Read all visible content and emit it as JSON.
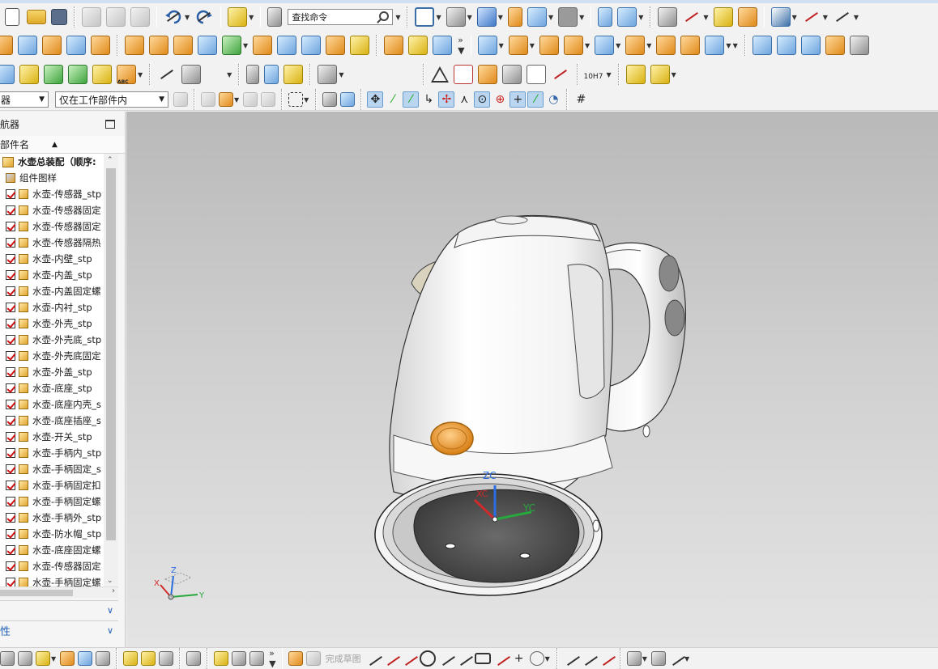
{
  "toolbar_top": {
    "search_placeholder": "查找命令"
  },
  "filter_bar": {
    "type_filter_value": "器",
    "scope_filter_value": "仅在工作部件内"
  },
  "navigator": {
    "title": "导航器",
    "column_header": "性部件名",
    "root": "水壶总装配（顺序:",
    "pattern": "组件图样",
    "items": [
      "水壶-传感器_stp",
      "水壶-传感器固定",
      "水壶-传感器固定",
      "水壶-传感器隔热",
      "水壶-内壁_stp",
      "水壶-内盖_stp",
      "水壶-内盖固定螺",
      "水壶-内衬_stp",
      "水壶-外壳_stp",
      "水壶-外壳底_stp",
      "水壶-外壳底固定",
      "水壶-外盖_stp",
      "水壶-底座_stp",
      "水壶-底座内壳_s",
      "水壶-底座插座_s",
      "水壶-开关_stp",
      "水壶-手柄内_stp",
      "水壶-手柄固定_s",
      "水壶-手柄固定扣",
      "水壶-手柄固定螺",
      "水壶-手柄外_stp",
      "水壶-防水帽_stp",
      "水壶-底座固定螺",
      "水壶-传感器固定",
      "水壶-手柄固定螺"
    ],
    "section_dependencies": "",
    "section_properties": "性"
  },
  "viewport": {
    "wcs_labels": {
      "zc": "ZC",
      "xc": "XC",
      "yc": "YC"
    },
    "triad_labels": {
      "x": "X",
      "y": "Y",
      "z": "Z"
    }
  },
  "bottom_toolbar": {
    "finish_sketch": "完成草图"
  },
  "toolbar_labels": {
    "tolerance_icon_text": "10H7",
    "abc_icon_text": "ABC"
  },
  "colors": {
    "accent_blue": "#1f5fb5",
    "check_red": "#d01010",
    "switch_orange": "#e89a2c",
    "wcs_z": "#2a6de0",
    "wcs_x": "#d02a2a",
    "wcs_y": "#27a83c"
  }
}
